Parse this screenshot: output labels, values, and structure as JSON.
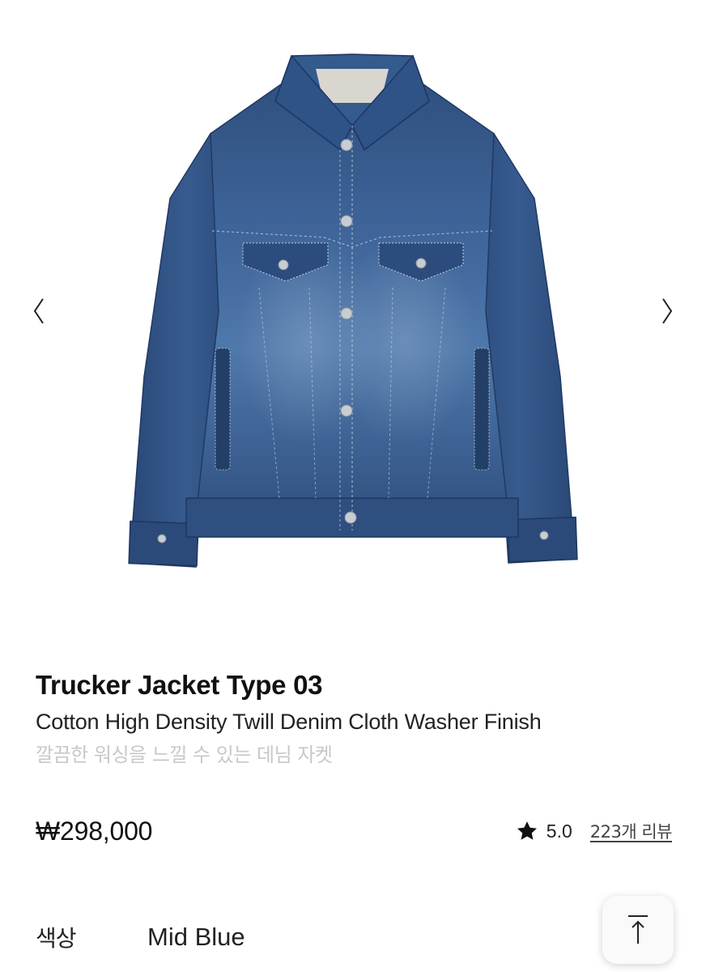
{
  "gallery": {
    "image_alt": "Trucker Jacket Type 03 mid blue denim jacket",
    "prev_icon": "chevron-left-icon",
    "next_icon": "chevron-right-icon"
  },
  "product": {
    "title": "Trucker Jacket Type 03",
    "subtitle": "Cotton High Density Twill Denim Cloth Washer Finish",
    "description_ko": "깔끔한 워싱을 느낄 수 있는 데님 자켓",
    "price": "₩298,000",
    "rating_icon": "star-icon",
    "rating_score": "5.0",
    "review_link": "223개 리뷰"
  },
  "option": {
    "label": "색상",
    "value": "Mid Blue"
  },
  "scroll_top": {
    "icon": "arrow-up-icon"
  },
  "colors": {
    "denim": "#34578a",
    "denim_dark": "#243f68",
    "muted_text": "#c8c8c8"
  }
}
